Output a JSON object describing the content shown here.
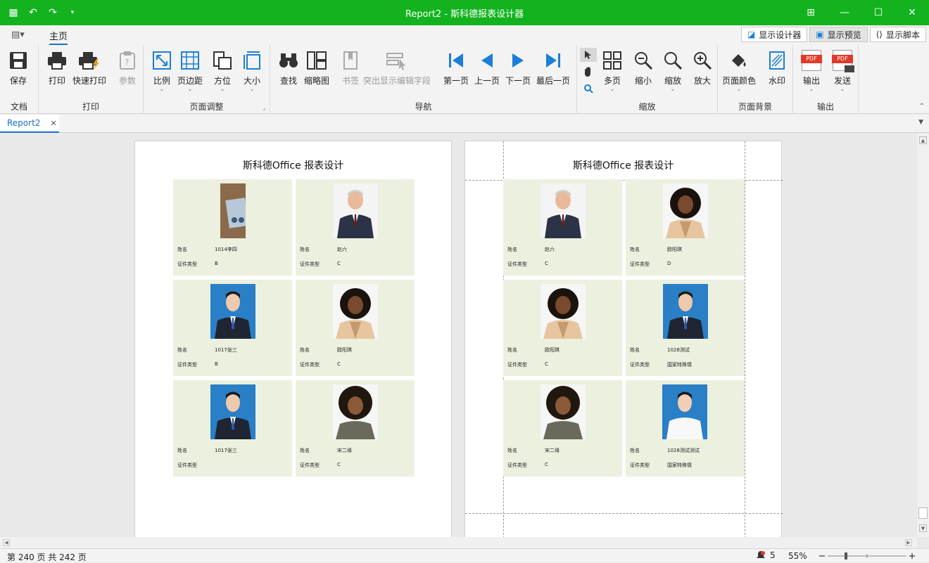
{
  "window": {
    "title": "Report2 - 斯科德报表设计器"
  },
  "tabs": {
    "home": "主页"
  },
  "view_buttons": [
    "显示设计器",
    "显示预览",
    "显示脚本"
  ],
  "ribbon": {
    "doc": {
      "label": "文档",
      "save": "保存"
    },
    "print": {
      "label": "打印",
      "print": "打印",
      "quick": "快速打印",
      "params": "参数"
    },
    "page": {
      "label": "页面调整",
      "scale": "比例",
      "margins": "页边距",
      "orient": "方位",
      "size": "大小"
    },
    "nav": {
      "label": "导航",
      "find": "查找",
      "thumbs": "缩略图",
      "bookmark": "书签",
      "highlight": "突出显示编辑字段",
      "first": "第一页",
      "prev": "上一页",
      "next": "下一页",
      "last": "最后一页"
    },
    "zoom": {
      "label": "缩放",
      "multi": "多页",
      "out": "缩小",
      "zoom": "缩放",
      "in": "放大"
    },
    "bg": {
      "label": "页面背景",
      "color": "页面颜色",
      "watermark": "水印"
    },
    "output": {
      "label": "输出",
      "export": "输出",
      "send": "发送",
      "pdf": "PDF"
    }
  },
  "doc_tab": "Report2",
  "report_title": "斯科德Office 报表设计",
  "field_labels": {
    "name": "姓名",
    "idtype": "证件类型"
  },
  "pages": [
    {
      "cards": [
        {
          "name": "1014李四",
          "type": "B"
        },
        {
          "name": "赵六",
          "type": "C"
        },
        {
          "name": "1017张三",
          "type": "B"
        },
        {
          "name": "欧阳琪",
          "type": "C"
        },
        {
          "name": "1017张三",
          "type": ""
        },
        {
          "name": "宋二缘",
          "type": "C"
        }
      ]
    },
    {
      "cards": [
        {
          "name": "赵六",
          "type": "C"
        },
        {
          "name": "欧阳琪",
          "type": "D"
        },
        {
          "name": "欧阳琪",
          "type": "C"
        },
        {
          "name": "1028测试",
          "type": "国家特殊情"
        },
        {
          "name": "宋二缘",
          "type": "C"
        },
        {
          "name": "1028测试测试",
          "type": "国家特殊情"
        }
      ]
    }
  ],
  "status": {
    "page_info": "第 240 页 共 242 页",
    "notifications": "5",
    "zoom": "55%"
  },
  "colors": {
    "accent": "#12b31f",
    "nav_blue": "#1a7fd6",
    "card_bg": "#ecf0df"
  }
}
